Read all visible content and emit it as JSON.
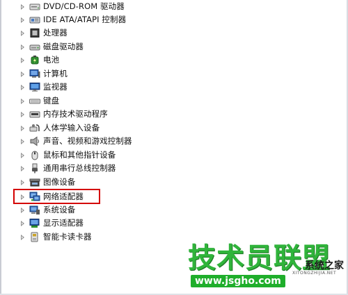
{
  "device_tree": {
    "items": [
      {
        "label": "DVD/CD-ROM 驱动器",
        "icon": "dvd-drive-icon"
      },
      {
        "label": "IDE ATA/ATAPI 控制器",
        "icon": "ide-controller-icon"
      },
      {
        "label": "处理器",
        "icon": "processor-icon"
      },
      {
        "label": "磁盘驱动器",
        "icon": "disk-drive-icon"
      },
      {
        "label": "电池",
        "icon": "battery-icon"
      },
      {
        "label": "计算机",
        "icon": "computer-icon"
      },
      {
        "label": "监视器",
        "icon": "monitor-icon"
      },
      {
        "label": "键盘",
        "icon": "keyboard-icon"
      },
      {
        "label": "内存技术驱动程序",
        "icon": "memory-device-icon"
      },
      {
        "label": "人体学输入设备",
        "icon": "hid-icon"
      },
      {
        "label": "声音、视频和游戏控制器",
        "icon": "speaker-icon"
      },
      {
        "label": "鼠标和其他指针设备",
        "icon": "mouse-icon"
      },
      {
        "label": "通用串行总线控制器",
        "icon": "usb-icon"
      },
      {
        "label": "图像设备",
        "icon": "camera-icon"
      },
      {
        "label": "网络适配器",
        "icon": "network-adapter-icon"
      },
      {
        "label": "系统设备",
        "icon": "system-device-icon"
      },
      {
        "label": "显示适配器",
        "icon": "display-adapter-icon"
      },
      {
        "label": "智能卡读卡器",
        "icon": "smart-card-reader-icon"
      }
    ],
    "highlighted_index": 14,
    "highlight_color": "#d40000"
  },
  "watermark": {
    "title": "技术员联盟",
    "right_text": "系统之家",
    "url": "www.jsgho.com",
    "subtitle": "XITONGZHIJIA.NET",
    "color": "#1fae2b"
  }
}
